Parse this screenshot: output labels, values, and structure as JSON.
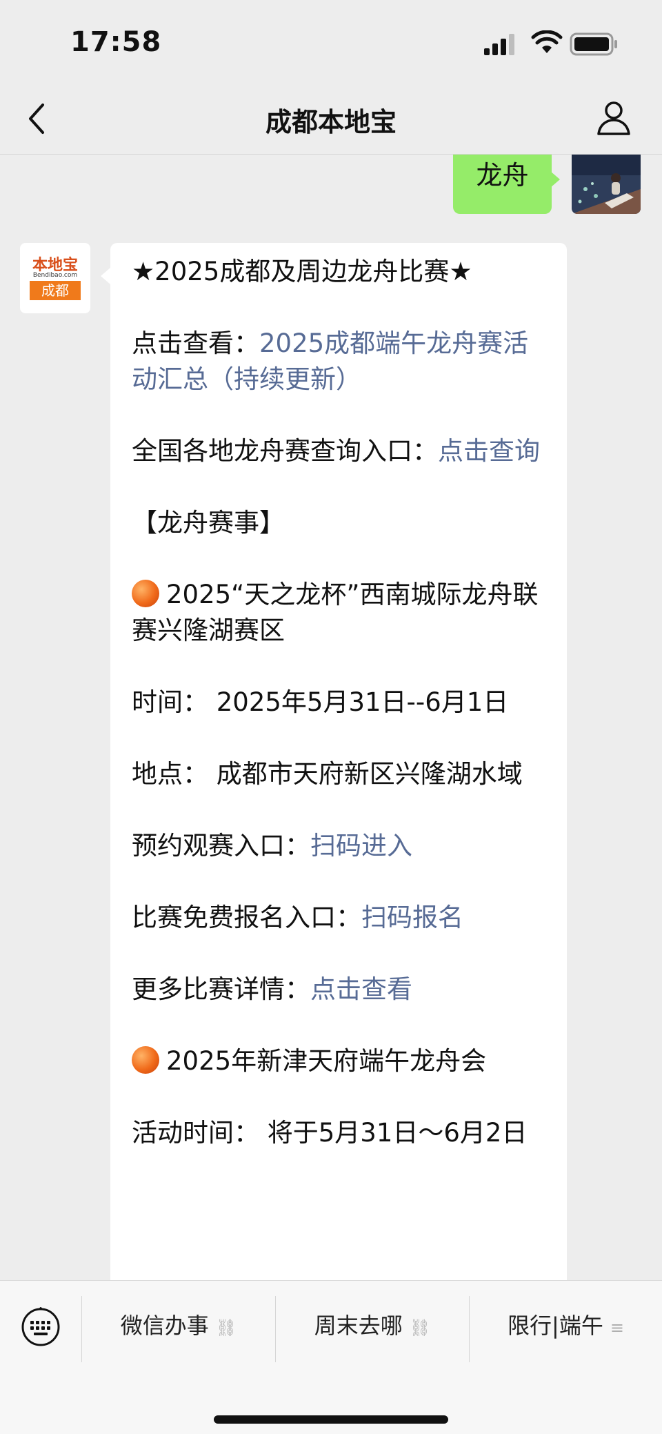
{
  "status": {
    "time": "17:58"
  },
  "nav": {
    "title": "成都本地宝"
  },
  "chat": {
    "sent_text": "龙舟",
    "bot_logo": {
      "top": "本地宝",
      "url": "Bendibao.com",
      "city": "成都"
    },
    "message": {
      "heading": "★2025成都及周边龙舟比赛★",
      "line1_prefix": "点击查看：",
      "line1_link": "2025成都端午龙舟赛活动汇总（持续更新）",
      "line2_prefix": "全国各地龙舟赛查询入口：",
      "line2_link": "点击查询",
      "section": "【龙舟赛事】",
      "event1_title": "2025“天之龙杯”西南城际龙舟联赛兴隆湖赛区",
      "event1_time": "时间： 2025年5月31日--6月1日",
      "event1_place": "地点： 成都市天府新区兴隆湖水域",
      "event1_booking_prefix": "预约观赛入口：",
      "event1_booking_link": "扫码进入",
      "event1_signup_prefix": "比赛免费报名入口：",
      "event1_signup_link": "扫码报名",
      "event1_more_prefix": "更多比赛详情：",
      "event1_more_link": "点击查看",
      "event2_title": "2025年新津天府端午龙舟会",
      "event2_time": "活动时间： 将于5月31日～6月2日"
    }
  },
  "menu": {
    "items": [
      {
        "label": "微信办事",
        "icon": "link-icon"
      },
      {
        "label": "周末去哪",
        "icon": "link-icon"
      },
      {
        "label": "限行|端午",
        "icon": "menu-lines-icon"
      }
    ]
  },
  "colors": {
    "link": "#576b95",
    "sent_bubble": "#95ec69",
    "background": "#ededed"
  }
}
